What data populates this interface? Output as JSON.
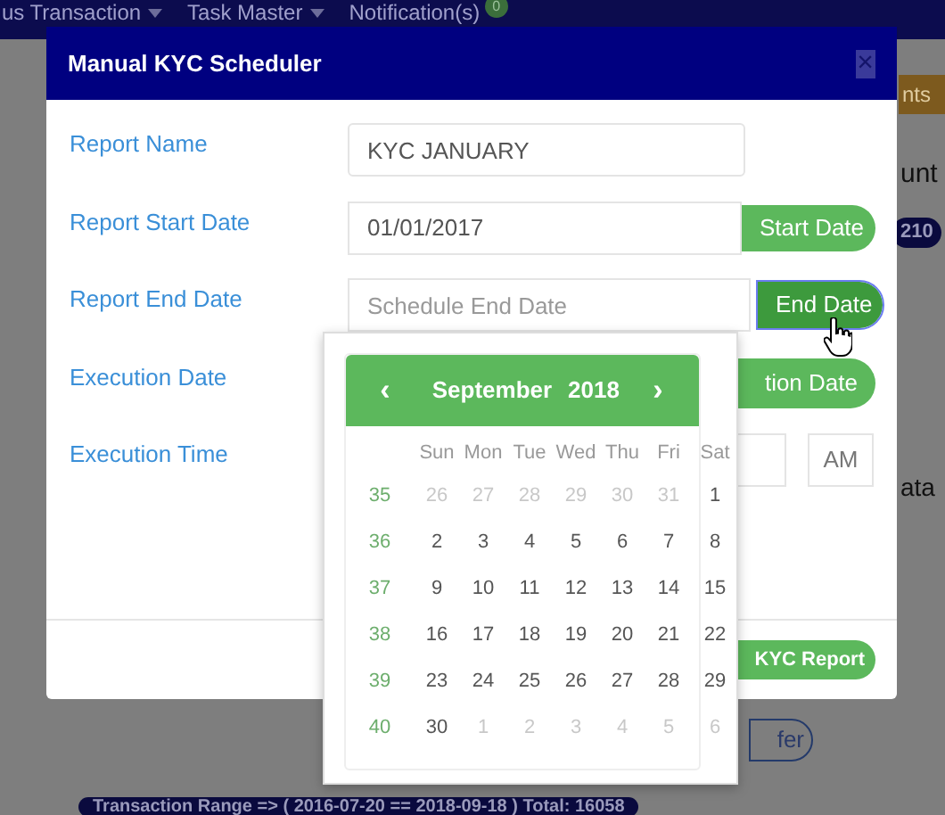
{
  "navbar": {
    "items": [
      {
        "label": "us Transaction",
        "kind": "dropdown"
      },
      {
        "label": "Task Master",
        "kind": "dropdown"
      },
      {
        "label": "Notification(s)",
        "kind": "badge",
        "badge": "0"
      }
    ]
  },
  "background": {
    "menu_button": "nts",
    "heading": "unt",
    "count_badge": "210",
    "heading_2": "ata",
    "pill_button": "fer",
    "range_badge": "Transaction Range => ( 2016-07-20 == 2018-09-18 ) Total: 16058"
  },
  "modal": {
    "title": "Manual KYC Scheduler",
    "close": "×",
    "rows": [
      {
        "label": "Report Name",
        "kind": "text",
        "value": "KYC JANUARY"
      },
      {
        "label": "Report Start Date",
        "kind": "date",
        "value": "01/01/2017",
        "button": "Start Date",
        "focused": false
      },
      {
        "label": "Report End Date",
        "kind": "date",
        "placeholder": "Schedule End Date",
        "button": "End Date",
        "focused": true
      },
      {
        "label": "Execution Date",
        "kind": "hidden-date",
        "button": "tion Date"
      },
      {
        "label": "Execution Time",
        "kind": "time",
        "meridiem": "AM"
      }
    ],
    "footer_button": "KYC Report"
  },
  "calendar": {
    "prev": "‹",
    "month": "September",
    "year": "2018",
    "next": "›",
    "weekdays": [
      "Sun",
      "Mon",
      "Tue",
      "Wed",
      "Thu",
      "Fri",
      "Sat"
    ],
    "weeks": [
      {
        "week": "35",
        "days": [
          {
            "d": "26",
            "outside": true
          },
          {
            "d": "27",
            "outside": true
          },
          {
            "d": "28",
            "outside": true
          },
          {
            "d": "29",
            "outside": true
          },
          {
            "d": "30",
            "outside": true
          },
          {
            "d": "31",
            "outside": true
          },
          {
            "d": "1",
            "outside": false
          }
        ]
      },
      {
        "week": "36",
        "days": [
          {
            "d": "2",
            "outside": false
          },
          {
            "d": "3",
            "outside": false
          },
          {
            "d": "4",
            "outside": false
          },
          {
            "d": "5",
            "outside": false
          },
          {
            "d": "6",
            "outside": false
          },
          {
            "d": "7",
            "outside": false
          },
          {
            "d": "8",
            "outside": false
          }
        ]
      },
      {
        "week": "37",
        "days": [
          {
            "d": "9",
            "outside": false
          },
          {
            "d": "10",
            "outside": false
          },
          {
            "d": "11",
            "outside": false
          },
          {
            "d": "12",
            "outside": false
          },
          {
            "d": "13",
            "outside": false
          },
          {
            "d": "14",
            "outside": false
          },
          {
            "d": "15",
            "outside": false
          }
        ]
      },
      {
        "week": "38",
        "days": [
          {
            "d": "16",
            "outside": false
          },
          {
            "d": "17",
            "outside": false
          },
          {
            "d": "18",
            "outside": false
          },
          {
            "d": "19",
            "outside": false
          },
          {
            "d": "20",
            "outside": false
          },
          {
            "d": "21",
            "outside": false
          },
          {
            "d": "22",
            "outside": false
          }
        ]
      },
      {
        "week": "39",
        "days": [
          {
            "d": "23",
            "outside": false
          },
          {
            "d": "24",
            "outside": false
          },
          {
            "d": "25",
            "outside": false
          },
          {
            "d": "26",
            "outside": false
          },
          {
            "d": "27",
            "outside": false
          },
          {
            "d": "28",
            "outside": false
          },
          {
            "d": "29",
            "outside": false
          }
        ]
      },
      {
        "week": "40",
        "days": [
          {
            "d": "30",
            "outside": false
          },
          {
            "d": "1",
            "outside": true
          },
          {
            "d": "2",
            "outside": true
          },
          {
            "d": "3",
            "outside": true
          },
          {
            "d": "4",
            "outside": true
          },
          {
            "d": "5",
            "outside": true
          },
          {
            "d": "6",
            "outside": true
          }
        ]
      }
    ]
  }
}
